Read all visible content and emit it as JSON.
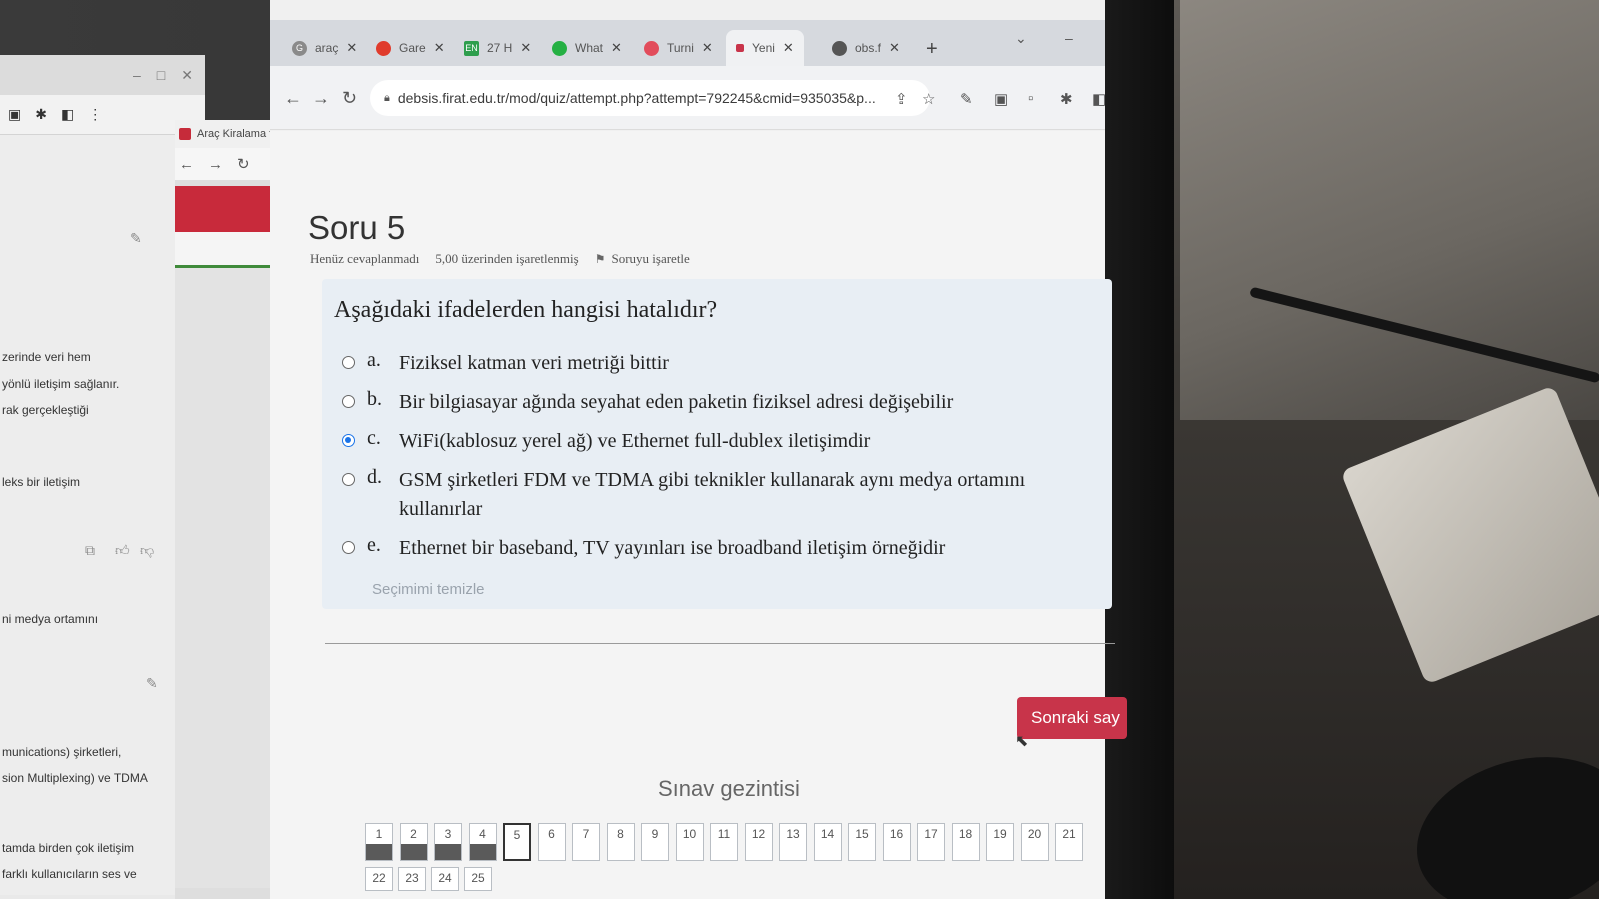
{
  "left_window": {
    "texts": [
      "zerinde veri hem",
      "yönlü iletişim sağlanır.",
      "rak gerçekleştiği",
      "leks bir iletişim",
      "ni medya ortamını",
      "munications) şirketleri,",
      "sion Multiplexing) ve TDMA",
      "tamda birden çok iletişim",
      "farklı kullanıcıların ses ve"
    ]
  },
  "mid_window": {
    "tab_label": "Araç Kiralama f"
  },
  "tabs": [
    {
      "label": "araç",
      "color": "#8a8a8a"
    },
    {
      "label": "Gare",
      "color": "#e03b2c"
    },
    {
      "label": "27 H",
      "color": "#2e9e4d"
    },
    {
      "label": "What",
      "color": "#25b043"
    },
    {
      "label": "Turni",
      "color": "#e24c5b"
    },
    {
      "label": "Yeni",
      "color": "#c8344a"
    },
    {
      "label": "obs.f",
      "color": "#555555"
    }
  ],
  "address": {
    "url": "debsis.firat.edu.tr/mod/quiz/attempt.php?attempt=792245&cmid=935035&p..."
  },
  "question": {
    "title": "Soru 5",
    "status": "Henüz cevaplanmadı",
    "marks": "5,00 üzerinden işaretlenmiş",
    "flag_label": "Soruyu işaretle",
    "text": "Aşağıdaki ifadelerden hangisi hatalıdır?",
    "answers": [
      {
        "letter": "a.",
        "text": "Fiziksel katman veri metriği bittir",
        "checked": false
      },
      {
        "letter": "b.",
        "text": "Bir bilgiasayar ağında seyahat eden paketin fiziksel adresi değişebilir",
        "checked": false
      },
      {
        "letter": "c.",
        "text": "WiFi(kablosuz yerel ağ) ve Ethernet full-dublex iletişimdir",
        "checked": true
      },
      {
        "letter": "d.",
        "text": "GSM şirketleri FDM ve TDMA gibi teknikler kullanarak aynı medya ortamını kullanırlar",
        "checked": false
      },
      {
        "letter": "e.",
        "text": "Ethernet bir baseband, TV yayınları ise broadband iletişim örneğidir",
        "checked": false
      }
    ],
    "clear_label": "Seçimimi temizle"
  },
  "next_button": "Sonraki say",
  "quiz_nav": {
    "title": "Sınav gezintisi",
    "row1": [
      "1",
      "2",
      "3",
      "4",
      "5",
      "6",
      "7",
      "8",
      "9",
      "10",
      "11",
      "12",
      "13",
      "14",
      "15",
      "16",
      "17",
      "18",
      "19",
      "20",
      "21"
    ],
    "row2": [
      "22",
      "23",
      "24",
      "25"
    ],
    "answered": [
      "1",
      "2",
      "3",
      "4"
    ],
    "current": "5"
  }
}
